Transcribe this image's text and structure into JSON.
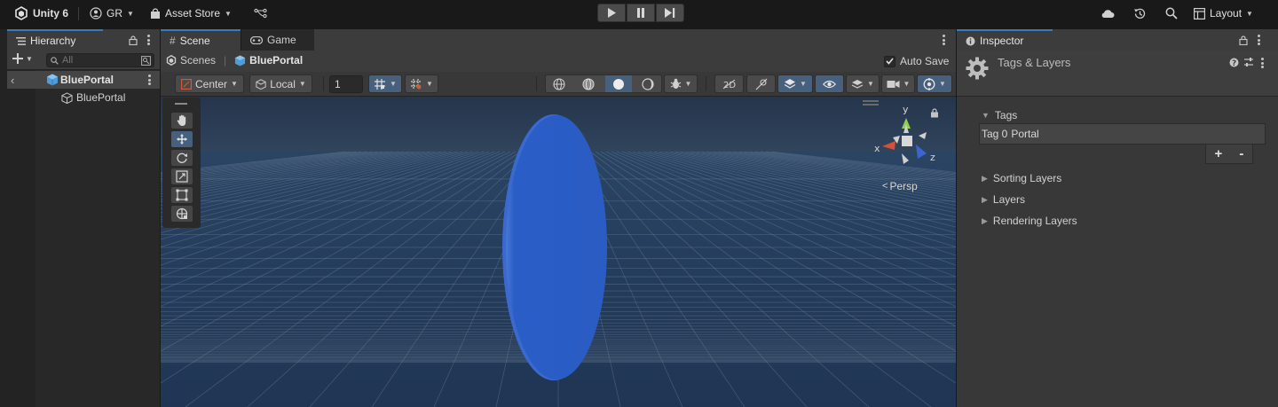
{
  "topbar": {
    "app_title": "Unity 6",
    "account": "GR",
    "asset_store": "Asset Store",
    "layout": "Layout"
  },
  "hierarchy": {
    "tab_label": "Hierarchy",
    "search_placeholder": "All",
    "scene_name": "BluePortal",
    "items": [
      {
        "label": "BluePortal"
      }
    ]
  },
  "scene_view": {
    "tabs": [
      {
        "label": "Scene"
      },
      {
        "label": "Game"
      }
    ],
    "breadcrumb": {
      "root": "Scenes",
      "current": "BluePortal"
    },
    "auto_save_label": "Auto Save",
    "auto_save_checked": true,
    "pivot_mode": "Center",
    "pivot_rotation": "Local",
    "grid_size": "1",
    "gizmo_axes": {
      "y": "y",
      "x": "x",
      "z": "z"
    },
    "projection_label": "Persp",
    "portal_color": "#2a5cc4",
    "sky_color": "#243852",
    "ground_color": "#223a59"
  },
  "inspector": {
    "tab_label": "Inspector",
    "title": "Tags & Layers",
    "tags_header": "Tags",
    "tag_items": [
      {
        "label": "Tag 0",
        "value": "Portal"
      }
    ],
    "add_label": "+",
    "remove_label": "-",
    "sections": [
      "Sorting Layers",
      "Layers",
      "Rendering Layers"
    ]
  },
  "colors": {
    "accent": "#3a79bb",
    "panel": "#383838",
    "dark": "#191919"
  }
}
